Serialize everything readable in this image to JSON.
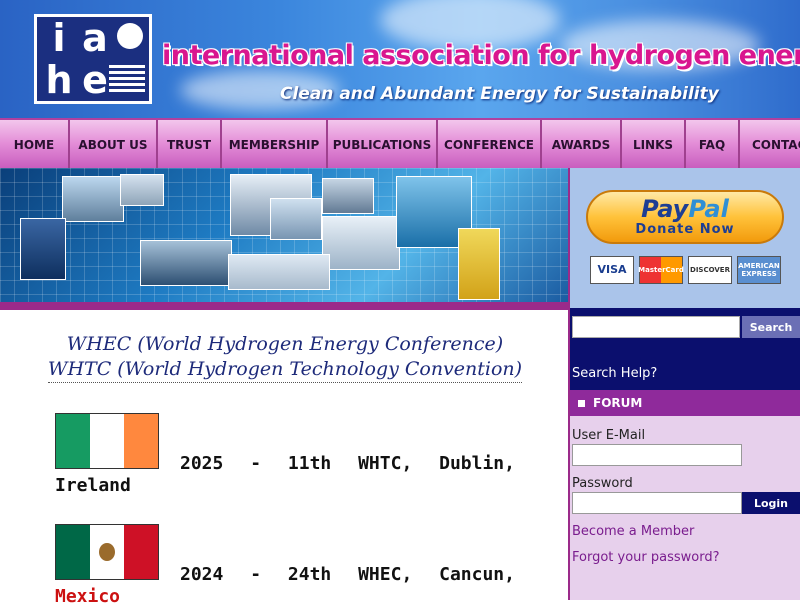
{
  "header": {
    "title": "international association for hydrogen energy",
    "tagline": "Clean and Abundant Energy for Sustainability",
    "logo_letters": [
      "i",
      "a",
      "h",
      "e"
    ]
  },
  "nav": {
    "items": [
      {
        "label": "HOME"
      },
      {
        "label": "ABOUT US"
      },
      {
        "label": "TRUST"
      },
      {
        "label": "MEMBERSHIP"
      },
      {
        "label": "PUBLICATIONS"
      },
      {
        "label": "CONFERENCE"
      },
      {
        "label": "AWARDS"
      },
      {
        "label": "LINKS"
      },
      {
        "label": "FAQ"
      },
      {
        "label": "CONTACT"
      }
    ]
  },
  "main": {
    "heading_line1": "WHEC (World Hydrogen Energy Conference)",
    "heading_line2": "WHTC (World Hydrogen Technology Convention)",
    "events": [
      {
        "line": "2025 - 11th WHTC, Dublin,",
        "country": "Ireland",
        "country_color": "#111111",
        "flag": "ireland-flag"
      },
      {
        "line": "2024 - 24th WHEC, Cancun,",
        "country": "Mexico",
        "country_color": "#cc1111",
        "flag": "mexico-flag"
      }
    ]
  },
  "sidebar": {
    "paypal": {
      "brand_pay": "Pay",
      "brand_pal": "Pal",
      "action": "Donate Now"
    },
    "cards": [
      "VISA",
      "MasterCard",
      "DISCOVER",
      "AMERICAN EXPRESS"
    ],
    "search": {
      "button": "Search",
      "help": "Search Help?",
      "value": ""
    },
    "forum": {
      "title": "FORUM",
      "email_label": "User E-Mail",
      "password_label": "Password",
      "login_button": "Login",
      "become_member": "Become a Member",
      "forgot_password": "Forgot your password?"
    }
  },
  "colors": {
    "title_magenta": "#d9168f",
    "nav_pink": "#e48fd8",
    "sidebar_navy": "#0b0f6e",
    "forum_purple": "#8f2a9b",
    "link_purple": "#7a1d8e"
  }
}
